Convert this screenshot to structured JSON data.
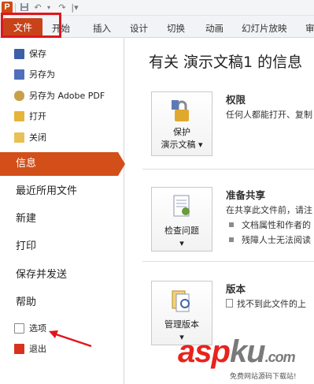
{
  "app": {
    "logo_letter": "P"
  },
  "quick_access": {
    "save_icon": "save-icon",
    "undo_icon": "undo-icon",
    "redo_icon": "redo-icon"
  },
  "tabs": [
    {
      "label": "文件"
    },
    {
      "label": "开始"
    },
    {
      "label": "插入"
    },
    {
      "label": "设计"
    },
    {
      "label": "切换"
    },
    {
      "label": "动画"
    },
    {
      "label": "幻灯片放映"
    },
    {
      "label": "审"
    }
  ],
  "left_panel": {
    "commands": [
      {
        "label": "保存",
        "icon": "save-icon"
      },
      {
        "label": "另存为",
        "icon": "save-as-icon"
      },
      {
        "label": "另存为 Adobe PDF",
        "icon": "pdf-icon"
      },
      {
        "label": "打开",
        "icon": "open-folder-icon"
      },
      {
        "label": "关闭",
        "icon": "close-folder-icon"
      }
    ],
    "nav": [
      {
        "label": "信息",
        "active": true
      },
      {
        "label": "最近所用文件"
      },
      {
        "label": "新建"
      },
      {
        "label": "打印"
      },
      {
        "label": "保存并发送"
      },
      {
        "label": "帮助"
      }
    ],
    "bottom_commands": [
      {
        "label": "选项",
        "icon": "options-icon"
      },
      {
        "label": "退出",
        "icon": "exit-icon"
      }
    ]
  },
  "main": {
    "title": "有关 演示文稿1 的信息",
    "sections": [
      {
        "button_line1": "保护",
        "button_line2": "演示文稿 ▾",
        "icon": "lock-key-icon",
        "heading": "权限",
        "text": "任何人都能打开、复制"
      },
      {
        "button_line1": "检查问题",
        "button_line2": "▾",
        "icon": "check-document-icon",
        "heading": "准备共享",
        "text": "在共享此文件前，请注",
        "bullets": [
          "文档属性和作者的",
          "残障人士无法阅读"
        ]
      },
      {
        "button_line1": "管理版本",
        "button_line2": "▾",
        "icon": "manage-versions-icon",
        "heading": "版本",
        "text": "找不到此文件的上"
      }
    ]
  },
  "watermark": {
    "brand_a": "asp",
    "brand_b": "ku",
    "brand_c": ".com",
    "sub": "免费网站源码下载站!"
  },
  "colors": {
    "accent": "#d24f19",
    "annotation": "#e0161d"
  }
}
